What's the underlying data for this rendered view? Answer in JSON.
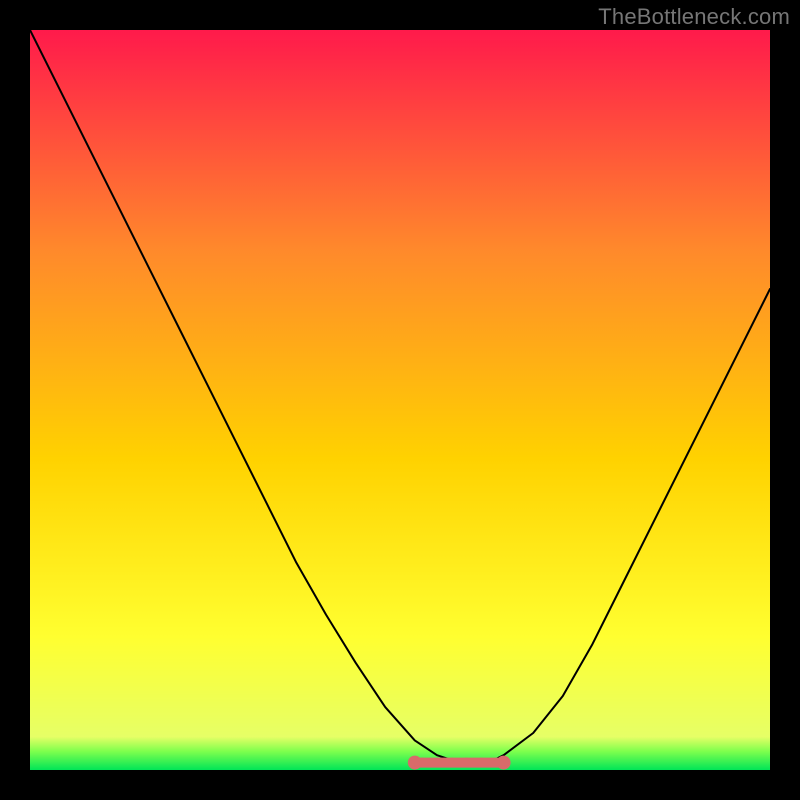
{
  "watermark": "TheBottleneck.com",
  "colors": {
    "gradient_top": "#ff1a4b",
    "gradient_mid_upper": "#ff8a2b",
    "gradient_mid": "#ffd200",
    "gradient_mid_lower": "#ffff30",
    "gradient_bottom": "#00e557",
    "curve": "#000000",
    "tail_stroke": "#d86a6a",
    "tail_fill": "#d86a6a",
    "tail_dot": "#d86a6a",
    "frame": "#000000"
  },
  "chart_data": {
    "type": "line",
    "title": "",
    "xlabel": "",
    "ylabel": "",
    "xlim": [
      0,
      100
    ],
    "ylim": [
      0,
      100
    ],
    "grid": false,
    "legend": false,
    "x": [
      0,
      4,
      8,
      12,
      16,
      20,
      24,
      28,
      32,
      36,
      40,
      44,
      48,
      52,
      55,
      58,
      60,
      62,
      64,
      68,
      72,
      76,
      80,
      84,
      88,
      92,
      96,
      100
    ],
    "series": [
      {
        "name": "curve",
        "values": [
          100,
          92,
          84,
          76,
          68,
          60,
          52,
          44,
          36,
          28,
          21,
          14.5,
          8.5,
          4,
          2,
          1,
          1,
          1,
          2,
          5,
          10,
          17,
          25,
          33,
          41,
          49,
          57,
          65
        ]
      }
    ],
    "tail_segment": {
      "x_start": 52,
      "x_end": 64,
      "y": 1,
      "dot_count": 6
    }
  }
}
